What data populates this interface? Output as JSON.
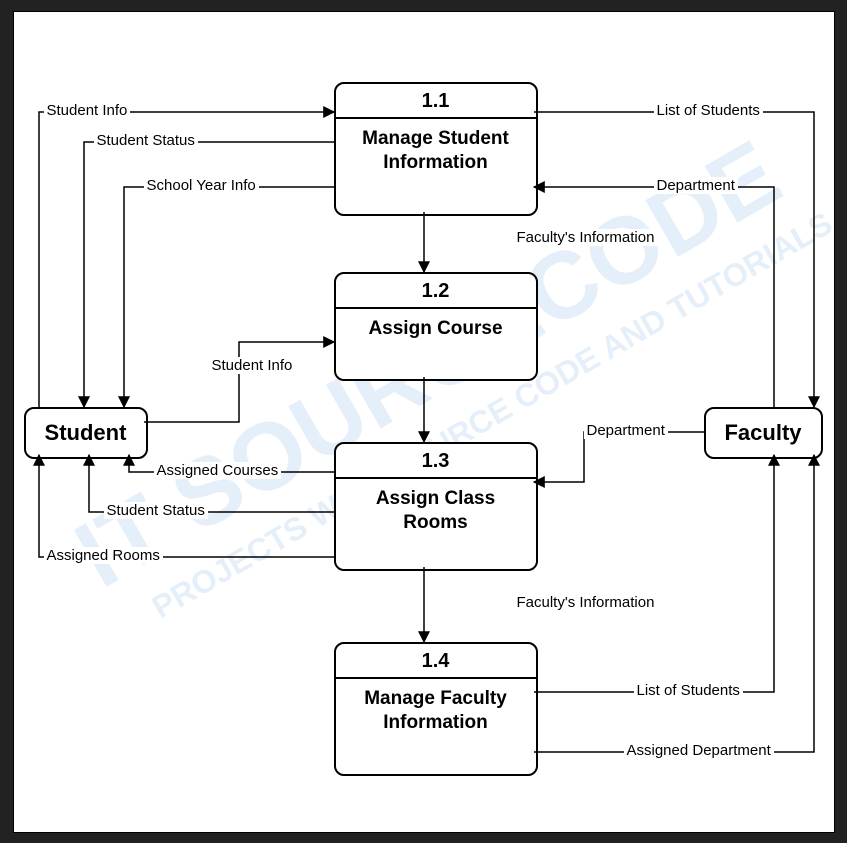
{
  "entities": {
    "student": "Student",
    "faculty": "Faculty"
  },
  "processes": {
    "p11": {
      "num": "1.1",
      "title": "Manage Student Information"
    },
    "p12": {
      "num": "1.2",
      "title": "Assign Course"
    },
    "p13": {
      "num": "1.3",
      "title": "Assign Class Rooms"
    },
    "p14": {
      "num": "1.4",
      "title": "Manage Faculty Information"
    }
  },
  "flows": {
    "student_info_1": "Student Info",
    "student_status_1": "Student Status",
    "school_year_info": "School Year Info",
    "list_of_students_1": "List of Students",
    "department_1": "Department",
    "facultys_information_1": "Faculty's Information",
    "student_info_2": "Student Info",
    "assigned_courses": "Assigned Courses",
    "department_2": "Department",
    "student_status_2": "Student Status",
    "assigned_rooms": "Assigned Rooms",
    "facultys_information_2": "Faculty's Information",
    "list_of_students_2": "List of Students",
    "assigned_department": "Assigned Department"
  },
  "watermark": {
    "line1": "IT SOURCECODE",
    "line2": "PROJECTS WITH SOURCE CODE AND TUTORIALS"
  }
}
